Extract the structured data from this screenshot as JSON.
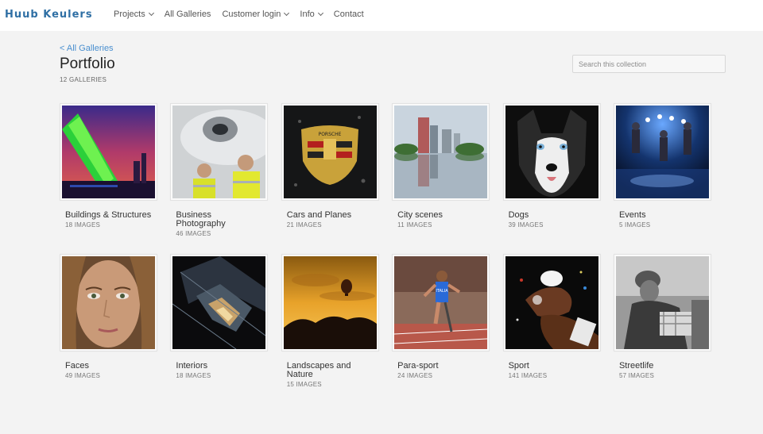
{
  "header": {
    "brand": "Huub Keulers",
    "nav": [
      {
        "label": "Projects",
        "dropdown": true
      },
      {
        "label": "All Galleries",
        "dropdown": false
      },
      {
        "label": "Customer login",
        "dropdown": true
      },
      {
        "label": "Info",
        "dropdown": true
      },
      {
        "label": "Contact",
        "dropdown": false
      }
    ]
  },
  "page": {
    "back_link": "< All Galleries",
    "title": "Portfolio",
    "gallery_count": "12 GALLERIES",
    "search_placeholder": "Search this collection"
  },
  "galleries": [
    {
      "title": "Buildings & Structures",
      "count": "18 IMAGES",
      "image": "green-lit-bridge-night"
    },
    {
      "title": "Business Photography",
      "count": "46 IMAGES",
      "image": "engineers-jet-engine"
    },
    {
      "title": "Cars and Planes",
      "count": "21 IMAGES",
      "image": "porsche-crest"
    },
    {
      "title": "City scenes",
      "count": "11 IMAGES",
      "image": "skyline-reflection"
    },
    {
      "title": "Dogs",
      "count": "39 IMAGES",
      "image": "husky-portrait"
    },
    {
      "title": "Events",
      "count": "5 IMAGES",
      "image": "dancers-stage"
    },
    {
      "title": "Faces",
      "count": "49 IMAGES",
      "image": "woman-portrait"
    },
    {
      "title": "Interiors",
      "count": "18 IMAGES",
      "image": "staircase"
    },
    {
      "title": "Landscapes and Nature",
      "count": "15 IMAGES",
      "image": "balloon-sunset"
    },
    {
      "title": "Para-sport",
      "count": "24 IMAGES",
      "image": "para-sprinter"
    },
    {
      "title": "Sport",
      "count": "141 IMAGES",
      "image": "hands-chalk"
    },
    {
      "title": "Streetlife",
      "count": "57 IMAGES",
      "image": "street-bw"
    }
  ]
}
